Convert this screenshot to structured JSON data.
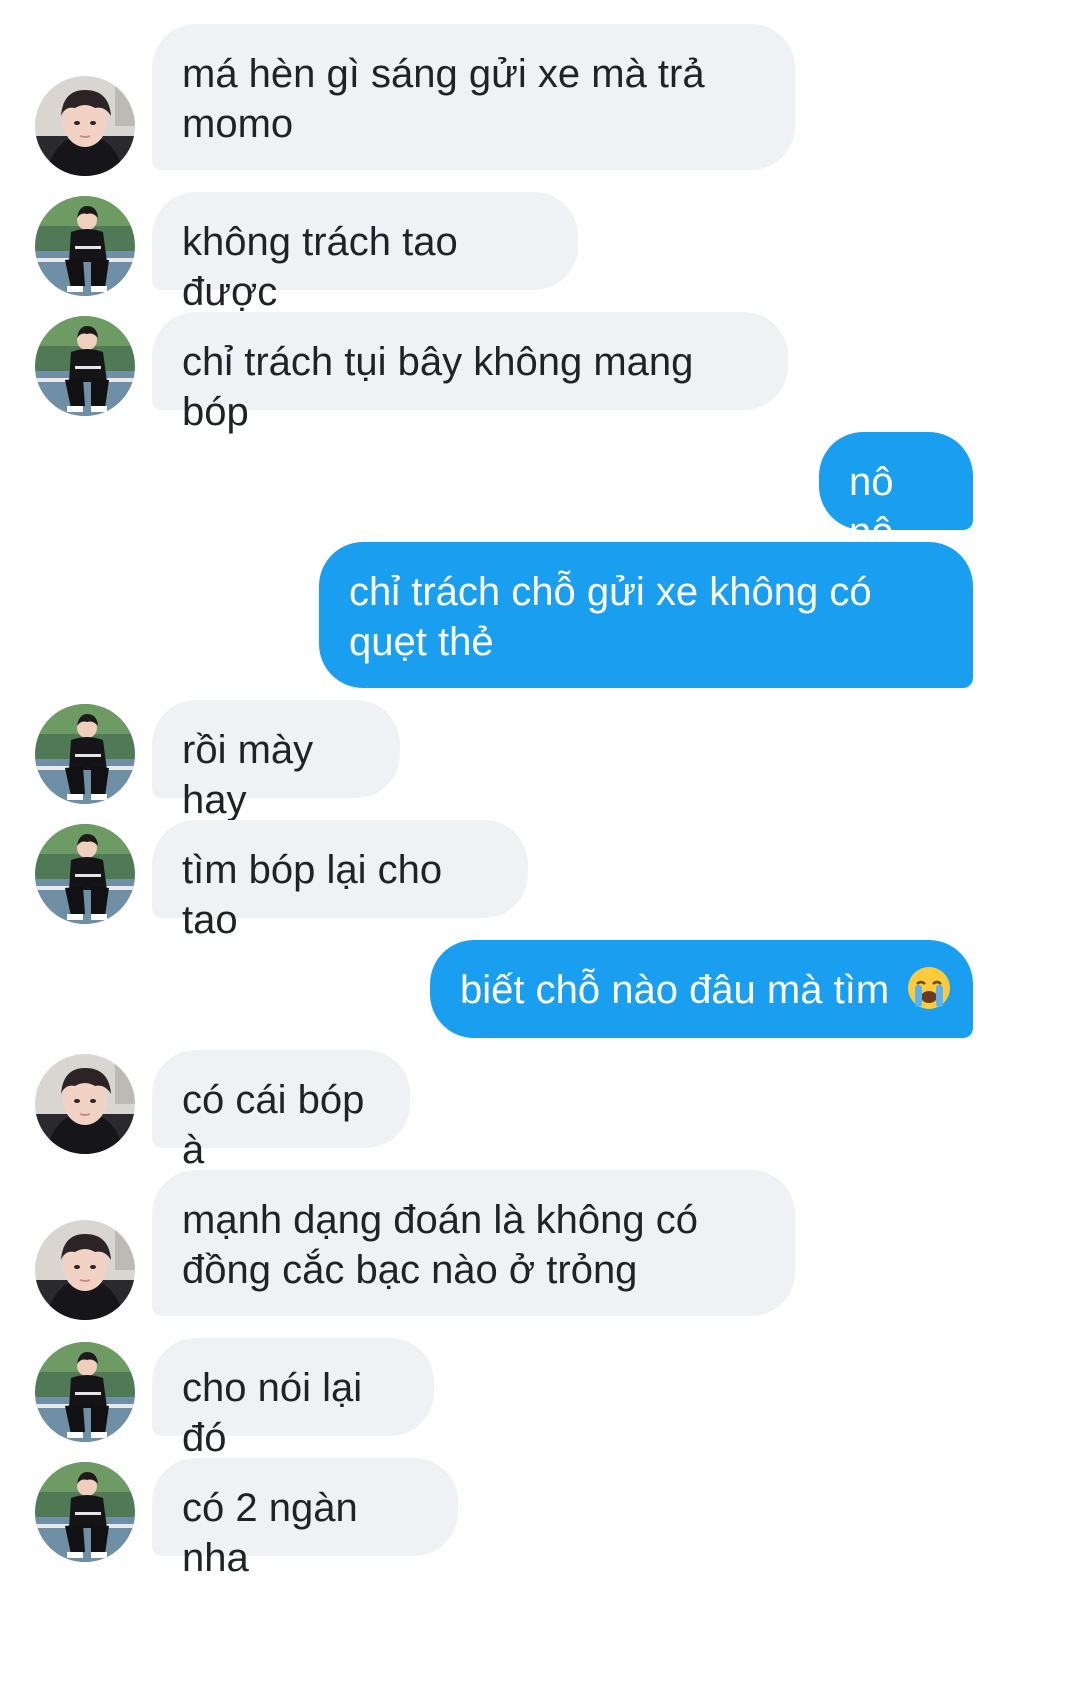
{
  "conversation": {
    "messages": [
      {
        "from": "them",
        "avatar": "avatar-face",
        "text": "má hèn gì sáng gửi xe mà trả momo"
      },
      {
        "from": "them",
        "avatar": "avatar-sitting",
        "text": "không trách tao được"
      },
      {
        "from": "them",
        "avatar": "avatar-sitting",
        "text": "chỉ trách tụi bây không mang bóp"
      },
      {
        "from": "me",
        "text": "nô nô"
      },
      {
        "from": "me",
        "text": "chỉ trách chỗ gửi xe không có quẹt thẻ"
      },
      {
        "from": "them",
        "avatar": "avatar-sitting",
        "text": "rồi mày hay"
      },
      {
        "from": "them",
        "avatar": "avatar-sitting",
        "text": "tìm bóp lại cho tao"
      },
      {
        "from": "me",
        "text": "biết chỗ nào đâu mà tìm",
        "emoji": "loudly-crying-face-icon"
      },
      {
        "from": "them",
        "avatar": "avatar-face",
        "text": "có cái bóp à"
      },
      {
        "from": "them",
        "avatar": "avatar-face",
        "text": "mạnh dạng đoán là không có đồng cắc bạc nào ở trỏng"
      },
      {
        "from": "them",
        "avatar": "avatar-sitting",
        "text": "cho nói lại đó"
      },
      {
        "from": "them",
        "avatar": "avatar-sitting",
        "text": "có 2 ngàn nha"
      }
    ]
  },
  "colors": {
    "incoming_bubble": "#eff1f5",
    "outgoing_bubble": "#1a9ff0",
    "incoming_text": "#1f2326",
    "outgoing_text": "#ffffff"
  }
}
